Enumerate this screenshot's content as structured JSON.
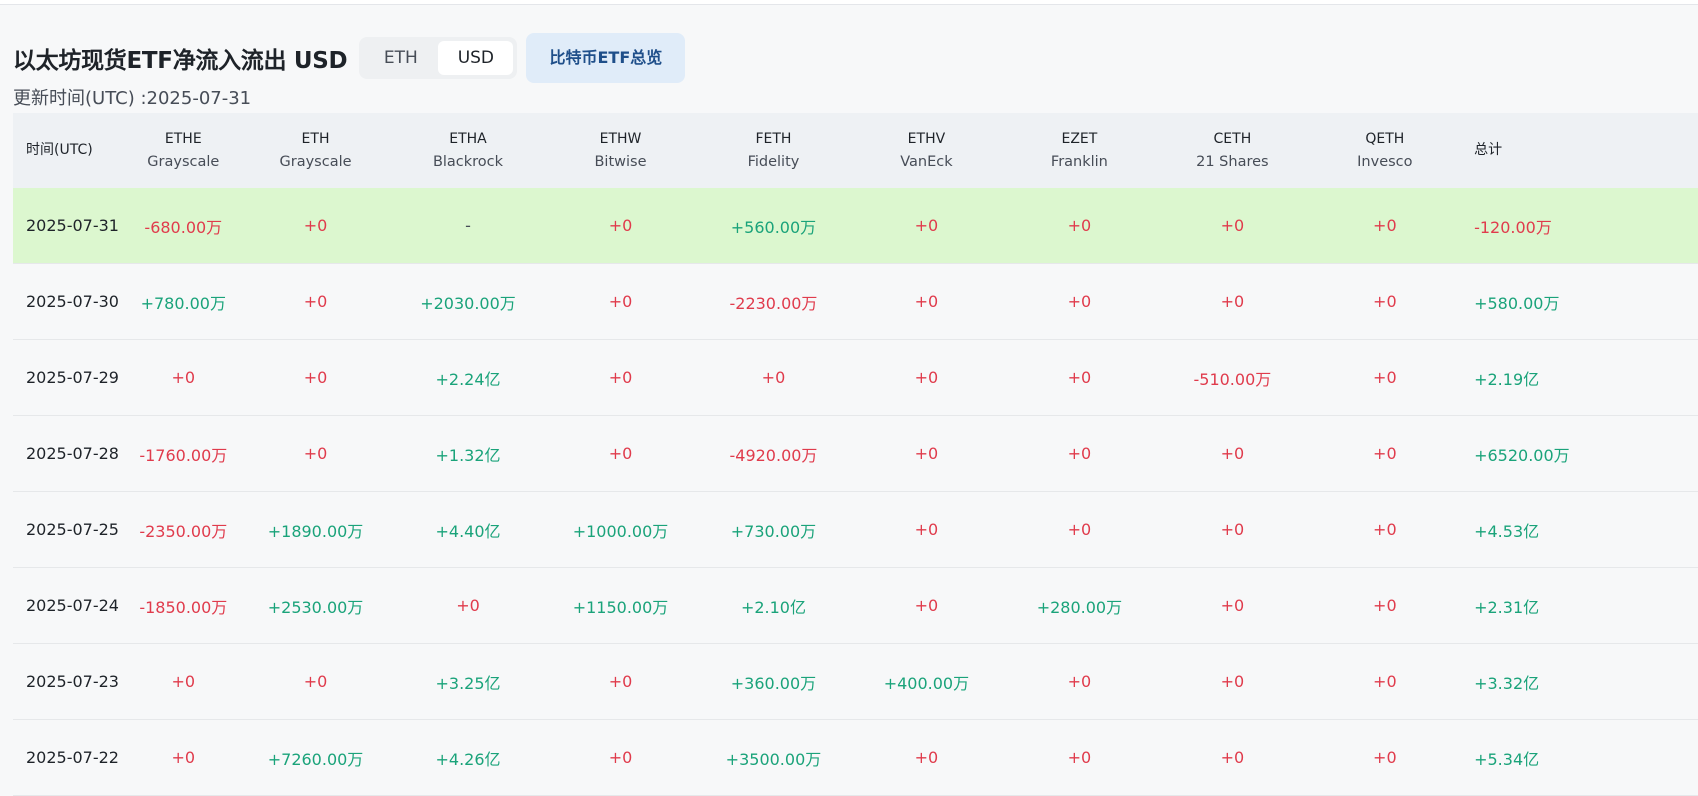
{
  "title": "以太坊现货ETF净流入流出 USD",
  "toggle": {
    "eth": "ETH",
    "usd": "USD"
  },
  "overview_button": "比特币ETF总览",
  "update_time": "更新时间(UTC) :2025-07-31",
  "headers": {
    "date": "时间(UTC)",
    "total": "总计",
    "funds": [
      {
        "ticker": "ETHE",
        "issuer": "Grayscale"
      },
      {
        "ticker": "ETH",
        "issuer": "Grayscale"
      },
      {
        "ticker": "ETHA",
        "issuer": "Blackrock"
      },
      {
        "ticker": "ETHW",
        "issuer": "Bitwise"
      },
      {
        "ticker": "FETH",
        "issuer": "Fidelity"
      },
      {
        "ticker": "ETHV",
        "issuer": "VanEck"
      },
      {
        "ticker": "EZET",
        "issuer": "Franklin"
      },
      {
        "ticker": "CETH",
        "issuer": "21 Shares"
      },
      {
        "ticker": "QETH",
        "issuer": "Invesco"
      }
    ]
  },
  "rows": [
    {
      "date": "2025-07-31",
      "values": [
        "-680.00万",
        "+0",
        "-",
        "+0",
        "+560.00万",
        "+0",
        "+0",
        "+0",
        "+0"
      ],
      "total": "-120.00万"
    },
    {
      "date": "2025-07-30",
      "values": [
        "+780.00万",
        "+0",
        "+2030.00万",
        "+0",
        "-2230.00万",
        "+0",
        "+0",
        "+0",
        "+0"
      ],
      "total": "+580.00万"
    },
    {
      "date": "2025-07-29",
      "values": [
        "+0",
        "+0",
        "+2.24亿",
        "+0",
        "+0",
        "+0",
        "+0",
        "-510.00万",
        "+0"
      ],
      "total": "+2.19亿"
    },
    {
      "date": "2025-07-28",
      "values": [
        "-1760.00万",
        "+0",
        "+1.32亿",
        "+0",
        "-4920.00万",
        "+0",
        "+0",
        "+0",
        "+0"
      ],
      "total": "+6520.00万"
    },
    {
      "date": "2025-07-25",
      "values": [
        "-2350.00万",
        "+1890.00万",
        "+4.40亿",
        "+1000.00万",
        "+730.00万",
        "+0",
        "+0",
        "+0",
        "+0"
      ],
      "total": "+4.53亿"
    },
    {
      "date": "2025-07-24",
      "values": [
        "-1850.00万",
        "+2530.00万",
        "+0",
        "+1150.00万",
        "+2.10亿",
        "+0",
        "+280.00万",
        "+0",
        "+0"
      ],
      "total": "+2.31亿"
    },
    {
      "date": "2025-07-23",
      "values": [
        "+0",
        "+0",
        "+3.25亿",
        "+0",
        "+360.00万",
        "+400.00万",
        "+0",
        "+0",
        "+0"
      ],
      "total": "+3.32亿"
    },
    {
      "date": "2025-07-22",
      "values": [
        "+0",
        "+7260.00万",
        "+4.26亿",
        "+0",
        "+3500.00万",
        "+0",
        "+0",
        "+0",
        "+0"
      ],
      "total": "+5.34亿"
    }
  ],
  "colors": {
    "positive": "#1aa37a",
    "negative": "#e03b4c",
    "highlight_row": "#dcf7cf"
  }
}
